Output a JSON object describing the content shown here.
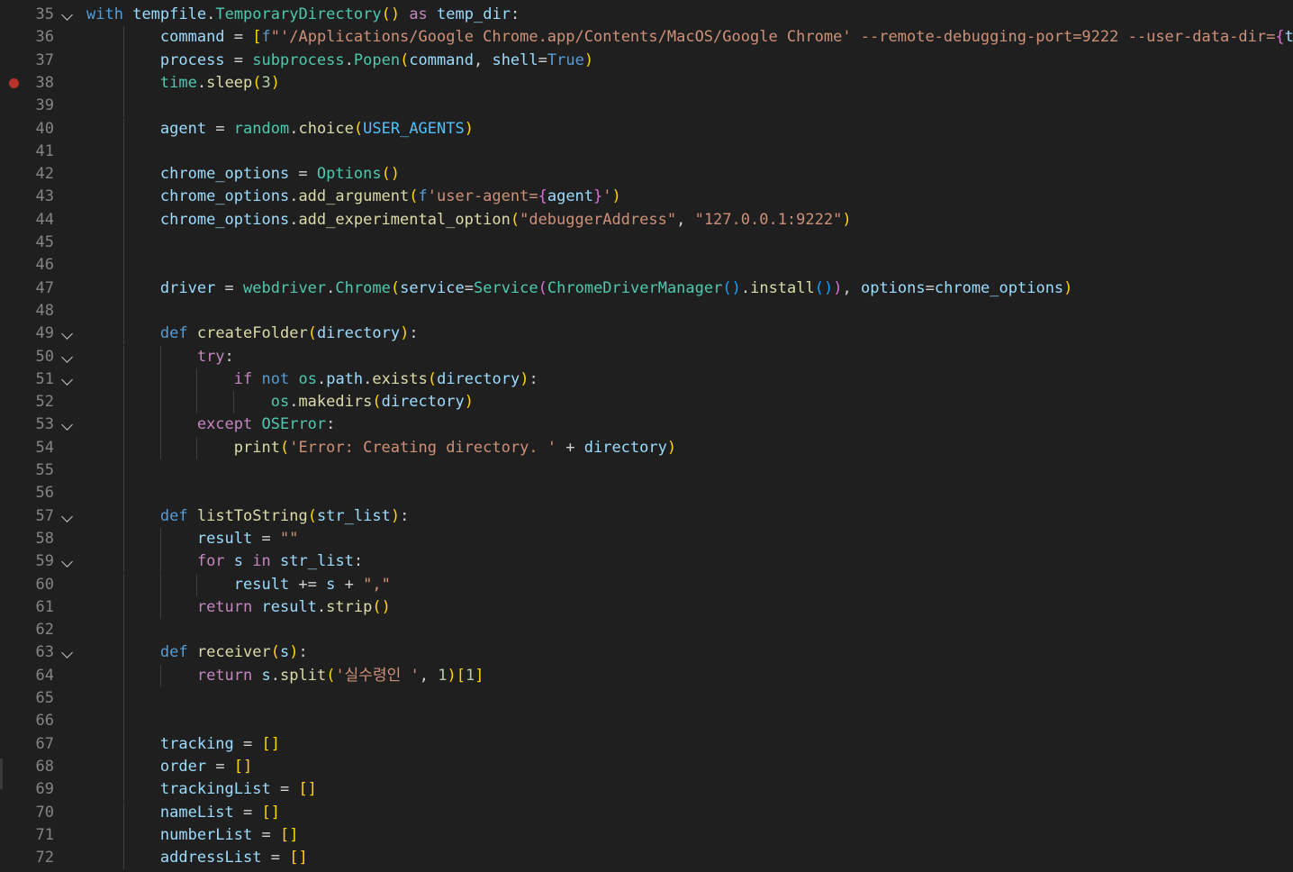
{
  "colors": {
    "background": "#1f1f1f",
    "line_number": "#858585",
    "breakpoint": "#b8322a",
    "keyword": "#569cd6",
    "control": "#c586c0",
    "variable": "#9cdcfe",
    "function": "#dcdcaa",
    "class": "#4ec9b0",
    "string": "#ce9178",
    "number": "#b5cea8",
    "bracket1": "#ffd700",
    "bracket2": "#da70d6",
    "bracket3": "#179fff"
  },
  "lines": [
    {
      "n": "35",
      "fold": true,
      "indent": 0,
      "tokens": [
        [
          "kw",
          "with"
        ],
        [
          "op",
          " "
        ],
        [
          "var",
          "tempfile"
        ],
        [
          "op",
          "."
        ],
        [
          "cls",
          "TemporaryDirectory"
        ],
        [
          "p1",
          "()"
        ],
        [
          "op",
          " "
        ],
        [
          "ctl",
          "as"
        ],
        [
          "op",
          " "
        ],
        [
          "var",
          "temp_dir"
        ],
        [
          "op",
          ":"
        ]
      ]
    },
    {
      "n": "36",
      "indent": 2,
      "tokens": [
        [
          "var",
          "command"
        ],
        [
          "op",
          " = "
        ],
        [
          "p1",
          "["
        ],
        [
          "strp",
          "f"
        ],
        [
          "str",
          "\"'/Applications/Google Chrome.app/Contents/MacOS/Google Chrome' --remote-debugging-port=9222 --user-data-dir="
        ],
        [
          "p2",
          "{"
        ],
        [
          "var",
          "te"
        ]
      ]
    },
    {
      "n": "37",
      "indent": 2,
      "tokens": [
        [
          "var",
          "process"
        ],
        [
          "op",
          " = "
        ],
        [
          "cls",
          "subprocess"
        ],
        [
          "op",
          "."
        ],
        [
          "cls",
          "Popen"
        ],
        [
          "p1",
          "("
        ],
        [
          "var",
          "command"
        ],
        [
          "op",
          ", "
        ],
        [
          "var",
          "shell"
        ],
        [
          "op",
          "="
        ],
        [
          "bool",
          "True"
        ],
        [
          "p1",
          ")"
        ]
      ]
    },
    {
      "n": "38",
      "bp": true,
      "indent": 2,
      "tokens": [
        [
          "cls",
          "time"
        ],
        [
          "op",
          "."
        ],
        [
          "fn",
          "sleep"
        ],
        [
          "p1",
          "("
        ],
        [
          "num",
          "3"
        ],
        [
          "p1",
          ")"
        ]
      ]
    },
    {
      "n": "39",
      "indent": 2,
      "tokens": []
    },
    {
      "n": "40",
      "indent": 2,
      "tokens": [
        [
          "var",
          "agent"
        ],
        [
          "op",
          " = "
        ],
        [
          "cls",
          "random"
        ],
        [
          "op",
          "."
        ],
        [
          "fn",
          "choice"
        ],
        [
          "p1",
          "("
        ],
        [
          "const",
          "USER_AGENTS"
        ],
        [
          "p1",
          ")"
        ]
      ]
    },
    {
      "n": "41",
      "indent": 2,
      "tokens": []
    },
    {
      "n": "42",
      "indent": 2,
      "tokens": [
        [
          "var",
          "chrome_options"
        ],
        [
          "op",
          " = "
        ],
        [
          "cls",
          "Options"
        ],
        [
          "p1",
          "()"
        ]
      ]
    },
    {
      "n": "43",
      "indent": 2,
      "tokens": [
        [
          "var",
          "chrome_options"
        ],
        [
          "op",
          "."
        ],
        [
          "fn",
          "add_argument"
        ],
        [
          "p1",
          "("
        ],
        [
          "strp",
          "f"
        ],
        [
          "str",
          "'user-agent="
        ],
        [
          "p2",
          "{"
        ],
        [
          "var",
          "agent"
        ],
        [
          "p2",
          "}"
        ],
        [
          "str",
          "'"
        ],
        [
          "p1",
          ")"
        ]
      ]
    },
    {
      "n": "44",
      "indent": 2,
      "tokens": [
        [
          "var",
          "chrome_options"
        ],
        [
          "op",
          "."
        ],
        [
          "fn",
          "add_experimental_option"
        ],
        [
          "p1",
          "("
        ],
        [
          "str",
          "\"debuggerAddress\""
        ],
        [
          "op",
          ", "
        ],
        [
          "str",
          "\"127.0.0.1:9222\""
        ],
        [
          "p1",
          ")"
        ]
      ]
    },
    {
      "n": "45",
      "indent": 2,
      "tokens": []
    },
    {
      "n": "46",
      "indent": 2,
      "tokens": []
    },
    {
      "n": "47",
      "indent": 2,
      "tokens": [
        [
          "var",
          "driver"
        ],
        [
          "op",
          " = "
        ],
        [
          "cls",
          "webdriver"
        ],
        [
          "op",
          "."
        ],
        [
          "cls",
          "Chrome"
        ],
        [
          "p1",
          "("
        ],
        [
          "var",
          "service"
        ],
        [
          "op",
          "="
        ],
        [
          "cls",
          "Service"
        ],
        [
          "p2",
          "("
        ],
        [
          "cls",
          "ChromeDriverManager"
        ],
        [
          "p3",
          "()"
        ],
        [
          "op",
          "."
        ],
        [
          "fn",
          "install"
        ],
        [
          "p3",
          "()"
        ],
        [
          "p2",
          ")"
        ],
        [
          "op",
          ", "
        ],
        [
          "var",
          "options"
        ],
        [
          "op",
          "="
        ],
        [
          "var",
          "chrome_options"
        ],
        [
          "p1",
          ")"
        ]
      ]
    },
    {
      "n": "48",
      "indent": 2,
      "tokens": []
    },
    {
      "n": "49",
      "fold": true,
      "indent": 2,
      "tokens": [
        [
          "kw",
          "def"
        ],
        [
          "op",
          " "
        ],
        [
          "fn",
          "createFolder"
        ],
        [
          "p1",
          "("
        ],
        [
          "var",
          "directory"
        ],
        [
          "p1",
          ")"
        ],
        [
          "op",
          ":"
        ]
      ]
    },
    {
      "n": "50",
      "fold": true,
      "indent": 3,
      "tokens": [
        [
          "ctl",
          "try"
        ],
        [
          "op",
          ":"
        ]
      ]
    },
    {
      "n": "51",
      "fold": true,
      "indent": 4,
      "tokens": [
        [
          "ctl",
          "if"
        ],
        [
          "op",
          " "
        ],
        [
          "kw",
          "not"
        ],
        [
          "op",
          " "
        ],
        [
          "cls",
          "os"
        ],
        [
          "op",
          "."
        ],
        [
          "var",
          "path"
        ],
        [
          "op",
          "."
        ],
        [
          "fn",
          "exists"
        ],
        [
          "p1",
          "("
        ],
        [
          "var",
          "directory"
        ],
        [
          "p1",
          ")"
        ],
        [
          "op",
          ":"
        ]
      ]
    },
    {
      "n": "52",
      "indent": 5,
      "tokens": [
        [
          "cls",
          "os"
        ],
        [
          "op",
          "."
        ],
        [
          "fn",
          "makedirs"
        ],
        [
          "p1",
          "("
        ],
        [
          "var",
          "directory"
        ],
        [
          "p1",
          ")"
        ]
      ]
    },
    {
      "n": "53",
      "fold": true,
      "indent": 3,
      "tokens": [
        [
          "ctl",
          "except"
        ],
        [
          "op",
          " "
        ],
        [
          "cls",
          "OSError"
        ],
        [
          "op",
          ":"
        ]
      ]
    },
    {
      "n": "54",
      "indent": 4,
      "tokens": [
        [
          "fn",
          "print"
        ],
        [
          "p1",
          "("
        ],
        [
          "str",
          "'Error: Creating directory. '"
        ],
        [
          "op",
          " + "
        ],
        [
          "var",
          "directory"
        ],
        [
          "p1",
          ")"
        ]
      ]
    },
    {
      "n": "55",
      "indent": 2,
      "tokens": []
    },
    {
      "n": "56",
      "indent": 2,
      "tokens": []
    },
    {
      "n": "57",
      "fold": true,
      "indent": 2,
      "tokens": [
        [
          "kw",
          "def"
        ],
        [
          "op",
          " "
        ],
        [
          "fn",
          "listToString"
        ],
        [
          "p1",
          "("
        ],
        [
          "var",
          "str_list"
        ],
        [
          "p1",
          ")"
        ],
        [
          "op",
          ":"
        ]
      ]
    },
    {
      "n": "58",
      "indent": 3,
      "tokens": [
        [
          "var",
          "result"
        ],
        [
          "op",
          " = "
        ],
        [
          "str",
          "\"\""
        ]
      ]
    },
    {
      "n": "59",
      "fold": true,
      "indent": 3,
      "tokens": [
        [
          "ctl",
          "for"
        ],
        [
          "op",
          " "
        ],
        [
          "var",
          "s"
        ],
        [
          "op",
          " "
        ],
        [
          "ctl",
          "in"
        ],
        [
          "op",
          " "
        ],
        [
          "var",
          "str_list"
        ],
        [
          "op",
          ":"
        ]
      ]
    },
    {
      "n": "60",
      "indent": 4,
      "tokens": [
        [
          "var",
          "result"
        ],
        [
          "op",
          " += "
        ],
        [
          "var",
          "s"
        ],
        [
          "op",
          " + "
        ],
        [
          "str",
          "\",\""
        ]
      ]
    },
    {
      "n": "61",
      "indent": 3,
      "tokens": [
        [
          "ctl",
          "return"
        ],
        [
          "op",
          " "
        ],
        [
          "var",
          "result"
        ],
        [
          "op",
          "."
        ],
        [
          "fn",
          "strip"
        ],
        [
          "p1",
          "()"
        ]
      ]
    },
    {
      "n": "62",
      "indent": 2,
      "tokens": []
    },
    {
      "n": "63",
      "fold": true,
      "indent": 2,
      "tokens": [
        [
          "kw",
          "def"
        ],
        [
          "op",
          " "
        ],
        [
          "fn",
          "receiver"
        ],
        [
          "p1",
          "("
        ],
        [
          "var",
          "s"
        ],
        [
          "p1",
          ")"
        ],
        [
          "op",
          ":"
        ]
      ]
    },
    {
      "n": "64",
      "indent": 3,
      "tokens": [
        [
          "ctl",
          "return"
        ],
        [
          "op",
          " "
        ],
        [
          "var",
          "s"
        ],
        [
          "op",
          "."
        ],
        [
          "fn",
          "split"
        ],
        [
          "p1",
          "("
        ],
        [
          "str",
          "'실수령인 '"
        ],
        [
          "op",
          ", "
        ],
        [
          "num",
          "1"
        ],
        [
          "p1",
          ")"
        ],
        [
          "p1",
          "["
        ],
        [
          "num",
          "1"
        ],
        [
          "p1",
          "]"
        ]
      ]
    },
    {
      "n": "65",
      "indent": 2,
      "tokens": []
    },
    {
      "n": "66",
      "indent": 2,
      "tokens": []
    },
    {
      "n": "67",
      "indent": 2,
      "tokens": [
        [
          "var",
          "tracking"
        ],
        [
          "op",
          " = "
        ],
        [
          "p1",
          "[]"
        ]
      ]
    },
    {
      "n": "68",
      "indent": 2,
      "tokens": [
        [
          "var",
          "order"
        ],
        [
          "op",
          " = "
        ],
        [
          "p1",
          "[]"
        ]
      ]
    },
    {
      "n": "69",
      "indent": 2,
      "tokens": [
        [
          "var",
          "trackingList"
        ],
        [
          "op",
          " = "
        ],
        [
          "p1",
          "[]"
        ]
      ]
    },
    {
      "n": "70",
      "indent": 2,
      "tokens": [
        [
          "var",
          "nameList"
        ],
        [
          "op",
          " = "
        ],
        [
          "p1",
          "[]"
        ]
      ]
    },
    {
      "n": "71",
      "indent": 2,
      "tokens": [
        [
          "var",
          "numberList"
        ],
        [
          "op",
          " = "
        ],
        [
          "p1",
          "[]"
        ]
      ]
    },
    {
      "n": "72",
      "indent": 2,
      "tokens": [
        [
          "var",
          "addressList"
        ],
        [
          "op",
          " = "
        ],
        [
          "p1",
          "[]"
        ]
      ]
    }
  ]
}
